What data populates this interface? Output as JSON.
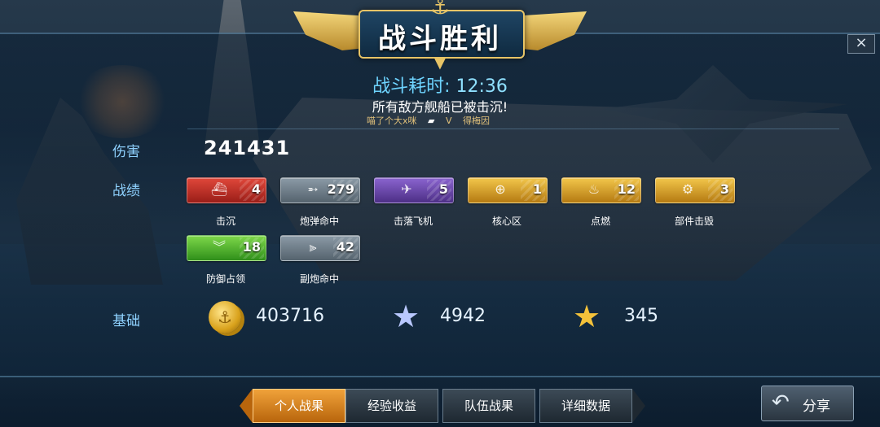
{
  "header": {
    "title": "战斗胜利",
    "close_label": "×"
  },
  "battle": {
    "time_label": "战斗耗时:",
    "time_value": "12:36",
    "message": "所有敌方舰船已被击沉!",
    "players": [
      "喵了个大x咪",
      "V",
      "得梅因"
    ]
  },
  "stats": {
    "damage_label": "伤害",
    "damage_value": "241431",
    "achievements_label": "战绩",
    "medals": [
      {
        "label": "击沉",
        "count": "4",
        "color": "red",
        "icon": "ship-icon"
      },
      {
        "label": "炮弹命中",
        "count": "279",
        "color": "gray",
        "icon": "shell-icon"
      },
      {
        "label": "击落飞机",
        "count": "5",
        "color": "purple",
        "icon": "plane-icon"
      },
      {
        "label": "核心区",
        "count": "1",
        "color": "gold",
        "icon": "citadel-icon"
      },
      {
        "label": "点燃",
        "count": "12",
        "color": "gold",
        "icon": "fire-icon"
      },
      {
        "label": "部件击毁",
        "count": "3",
        "color": "gold",
        "icon": "gear-icon"
      },
      {
        "label": "防御占领",
        "count": "18",
        "color": "green",
        "icon": "chevron-icon"
      },
      {
        "label": "副炮命中",
        "count": "42",
        "color": "gray",
        "icon": "secondary-gun-icon"
      }
    ],
    "base_label": "基础",
    "resources": [
      {
        "icon": "coin-icon",
        "value": "403716"
      },
      {
        "icon": "silver-star-icon",
        "value": "4942"
      },
      {
        "icon": "gold-star-icon",
        "value": "345"
      }
    ]
  },
  "tabs": [
    {
      "label": "个人战果",
      "active": true
    },
    {
      "label": "经验收益",
      "active": false
    },
    {
      "label": "队伍战果",
      "active": false
    },
    {
      "label": "详细数据",
      "active": false
    }
  ],
  "share": {
    "label": "分享"
  },
  "colors": {
    "accent": "#8fd2ff",
    "active_tab": "#f0a23a",
    "gold": "#e7c466"
  }
}
